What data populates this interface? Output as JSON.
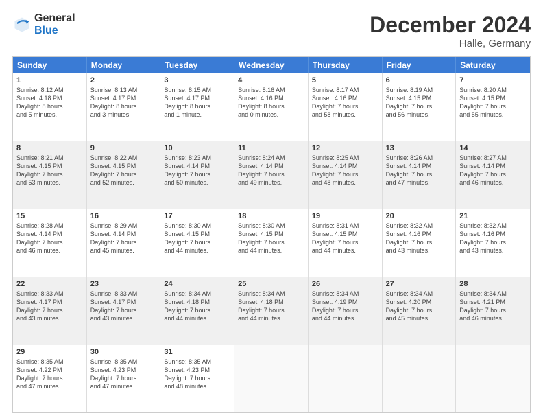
{
  "logo": {
    "general": "General",
    "blue": "Blue"
  },
  "header": {
    "month": "December 2024",
    "location": "Halle, Germany"
  },
  "days": [
    "Sunday",
    "Monday",
    "Tuesday",
    "Wednesday",
    "Thursday",
    "Friday",
    "Saturday"
  ],
  "weeks": [
    [
      {
        "day": "1",
        "text": "Sunrise: 8:12 AM\nSunset: 4:18 PM\nDaylight: 8 hours\nand 5 minutes.",
        "shaded": false
      },
      {
        "day": "2",
        "text": "Sunrise: 8:13 AM\nSunset: 4:17 PM\nDaylight: 8 hours\nand 3 minutes.",
        "shaded": false
      },
      {
        "day": "3",
        "text": "Sunrise: 8:15 AM\nSunset: 4:17 PM\nDaylight: 8 hours\nand 1 minute.",
        "shaded": false
      },
      {
        "day": "4",
        "text": "Sunrise: 8:16 AM\nSunset: 4:16 PM\nDaylight: 8 hours\nand 0 minutes.",
        "shaded": false
      },
      {
        "day": "5",
        "text": "Sunrise: 8:17 AM\nSunset: 4:16 PM\nDaylight: 7 hours\nand 58 minutes.",
        "shaded": false
      },
      {
        "day": "6",
        "text": "Sunrise: 8:19 AM\nSunset: 4:15 PM\nDaylight: 7 hours\nand 56 minutes.",
        "shaded": false
      },
      {
        "day": "7",
        "text": "Sunrise: 8:20 AM\nSunset: 4:15 PM\nDaylight: 7 hours\nand 55 minutes.",
        "shaded": false
      }
    ],
    [
      {
        "day": "8",
        "text": "Sunrise: 8:21 AM\nSunset: 4:15 PM\nDaylight: 7 hours\nand 53 minutes.",
        "shaded": true
      },
      {
        "day": "9",
        "text": "Sunrise: 8:22 AM\nSunset: 4:15 PM\nDaylight: 7 hours\nand 52 minutes.",
        "shaded": true
      },
      {
        "day": "10",
        "text": "Sunrise: 8:23 AM\nSunset: 4:14 PM\nDaylight: 7 hours\nand 50 minutes.",
        "shaded": true
      },
      {
        "day": "11",
        "text": "Sunrise: 8:24 AM\nSunset: 4:14 PM\nDaylight: 7 hours\nand 49 minutes.",
        "shaded": true
      },
      {
        "day": "12",
        "text": "Sunrise: 8:25 AM\nSunset: 4:14 PM\nDaylight: 7 hours\nand 48 minutes.",
        "shaded": true
      },
      {
        "day": "13",
        "text": "Sunrise: 8:26 AM\nSunset: 4:14 PM\nDaylight: 7 hours\nand 47 minutes.",
        "shaded": true
      },
      {
        "day": "14",
        "text": "Sunrise: 8:27 AM\nSunset: 4:14 PM\nDaylight: 7 hours\nand 46 minutes.",
        "shaded": true
      }
    ],
    [
      {
        "day": "15",
        "text": "Sunrise: 8:28 AM\nSunset: 4:14 PM\nDaylight: 7 hours\nand 46 minutes.",
        "shaded": false
      },
      {
        "day": "16",
        "text": "Sunrise: 8:29 AM\nSunset: 4:14 PM\nDaylight: 7 hours\nand 45 minutes.",
        "shaded": false
      },
      {
        "day": "17",
        "text": "Sunrise: 8:30 AM\nSunset: 4:15 PM\nDaylight: 7 hours\nand 44 minutes.",
        "shaded": false
      },
      {
        "day": "18",
        "text": "Sunrise: 8:30 AM\nSunset: 4:15 PM\nDaylight: 7 hours\nand 44 minutes.",
        "shaded": false
      },
      {
        "day": "19",
        "text": "Sunrise: 8:31 AM\nSunset: 4:15 PM\nDaylight: 7 hours\nand 44 minutes.",
        "shaded": false
      },
      {
        "day": "20",
        "text": "Sunrise: 8:32 AM\nSunset: 4:16 PM\nDaylight: 7 hours\nand 43 minutes.",
        "shaded": false
      },
      {
        "day": "21",
        "text": "Sunrise: 8:32 AM\nSunset: 4:16 PM\nDaylight: 7 hours\nand 43 minutes.",
        "shaded": false
      }
    ],
    [
      {
        "day": "22",
        "text": "Sunrise: 8:33 AM\nSunset: 4:17 PM\nDaylight: 7 hours\nand 43 minutes.",
        "shaded": true
      },
      {
        "day": "23",
        "text": "Sunrise: 8:33 AM\nSunset: 4:17 PM\nDaylight: 7 hours\nand 43 minutes.",
        "shaded": true
      },
      {
        "day": "24",
        "text": "Sunrise: 8:34 AM\nSunset: 4:18 PM\nDaylight: 7 hours\nand 44 minutes.",
        "shaded": true
      },
      {
        "day": "25",
        "text": "Sunrise: 8:34 AM\nSunset: 4:18 PM\nDaylight: 7 hours\nand 44 minutes.",
        "shaded": true
      },
      {
        "day": "26",
        "text": "Sunrise: 8:34 AM\nSunset: 4:19 PM\nDaylight: 7 hours\nand 44 minutes.",
        "shaded": true
      },
      {
        "day": "27",
        "text": "Sunrise: 8:34 AM\nSunset: 4:20 PM\nDaylight: 7 hours\nand 45 minutes.",
        "shaded": true
      },
      {
        "day": "28",
        "text": "Sunrise: 8:34 AM\nSunset: 4:21 PM\nDaylight: 7 hours\nand 46 minutes.",
        "shaded": true
      }
    ],
    [
      {
        "day": "29",
        "text": "Sunrise: 8:35 AM\nSunset: 4:22 PM\nDaylight: 7 hours\nand 47 minutes.",
        "shaded": false
      },
      {
        "day": "30",
        "text": "Sunrise: 8:35 AM\nSunset: 4:23 PM\nDaylight: 7 hours\nand 47 minutes.",
        "shaded": false
      },
      {
        "day": "31",
        "text": "Sunrise: 8:35 AM\nSunset: 4:23 PM\nDaylight: 7 hours\nand 48 minutes.",
        "shaded": false
      },
      {
        "day": "",
        "text": "",
        "shaded": false,
        "empty": true
      },
      {
        "day": "",
        "text": "",
        "shaded": false,
        "empty": true
      },
      {
        "day": "",
        "text": "",
        "shaded": false,
        "empty": true
      },
      {
        "day": "",
        "text": "",
        "shaded": false,
        "empty": true
      }
    ]
  ]
}
